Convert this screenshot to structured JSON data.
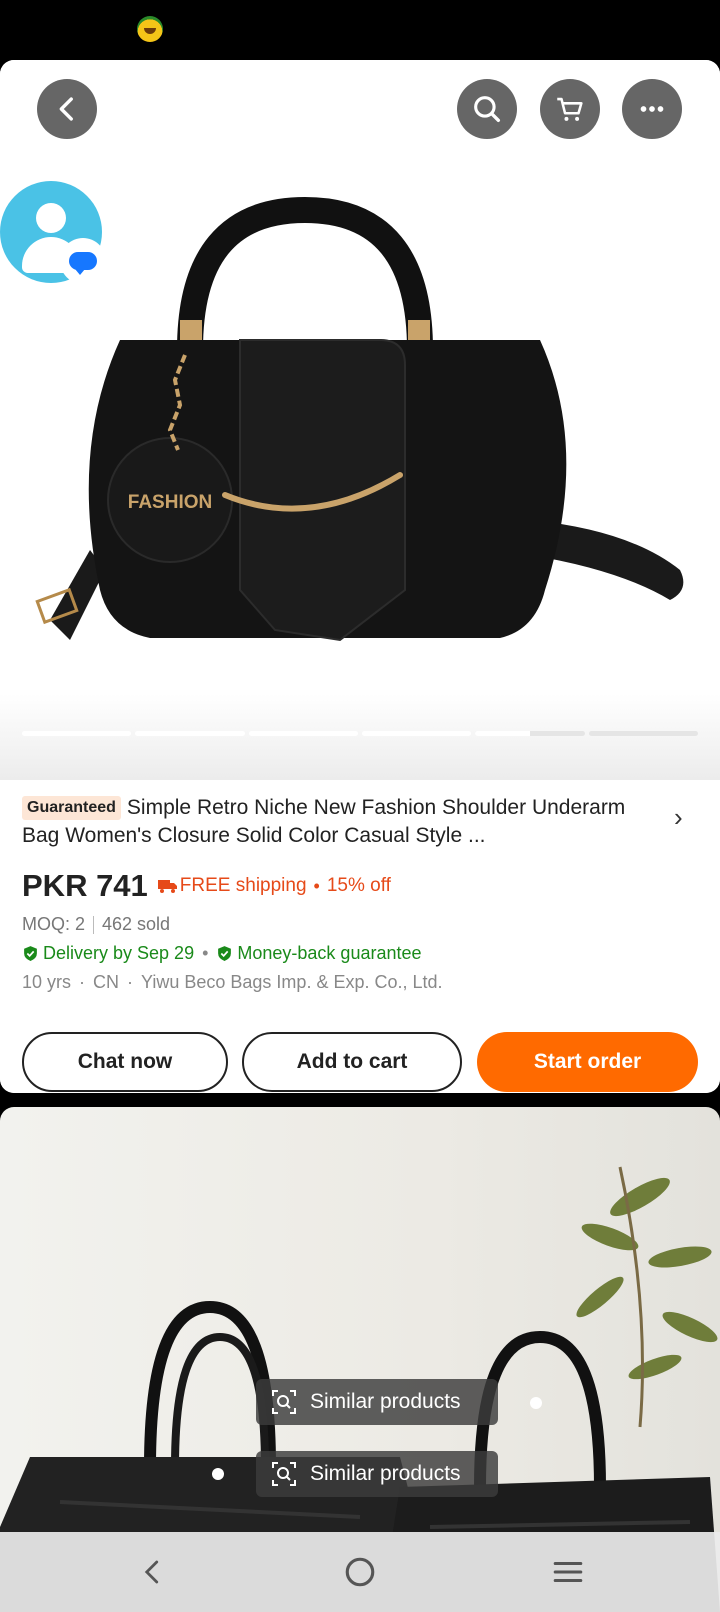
{
  "status_bar": {
    "emoji_icon": "cartoon-face-icon"
  },
  "toolbar": {
    "back_icon": "chevron-left-icon",
    "search_icon": "search-icon",
    "cart_icon": "cart-icon",
    "more_icon": "more-dots-icon"
  },
  "gallery": {
    "image_text": "FASHION",
    "page_count": 6,
    "current_page": 5,
    "current_progress": 0.5
  },
  "product": {
    "badge": "Guaranteed",
    "title": "Simple Retro Niche New Fashion Shoulder Underarm Bag Women's Closure Solid Color Casual Style ...",
    "price": "PKR 741",
    "shipping": "FREE shipping",
    "discount": "15% off",
    "moq": "MOQ: 2",
    "sold": "462 sold",
    "delivery": "Delivery by Sep 29",
    "guarantee": "Money-back guarantee",
    "years": "10 yrs",
    "country": "CN",
    "supplier": "Yiwu Beco Bags Imp. & Exp. Co., Ltd."
  },
  "actions": {
    "chat": "Chat now",
    "add_to_cart": "Add to cart",
    "start_order": "Start order"
  },
  "similar": {
    "label_1": "Similar products",
    "label_2": "Similar products"
  },
  "colors": {
    "accent": "#ff6a00",
    "promo": "#e64a19",
    "success": "#1a8a1a"
  }
}
